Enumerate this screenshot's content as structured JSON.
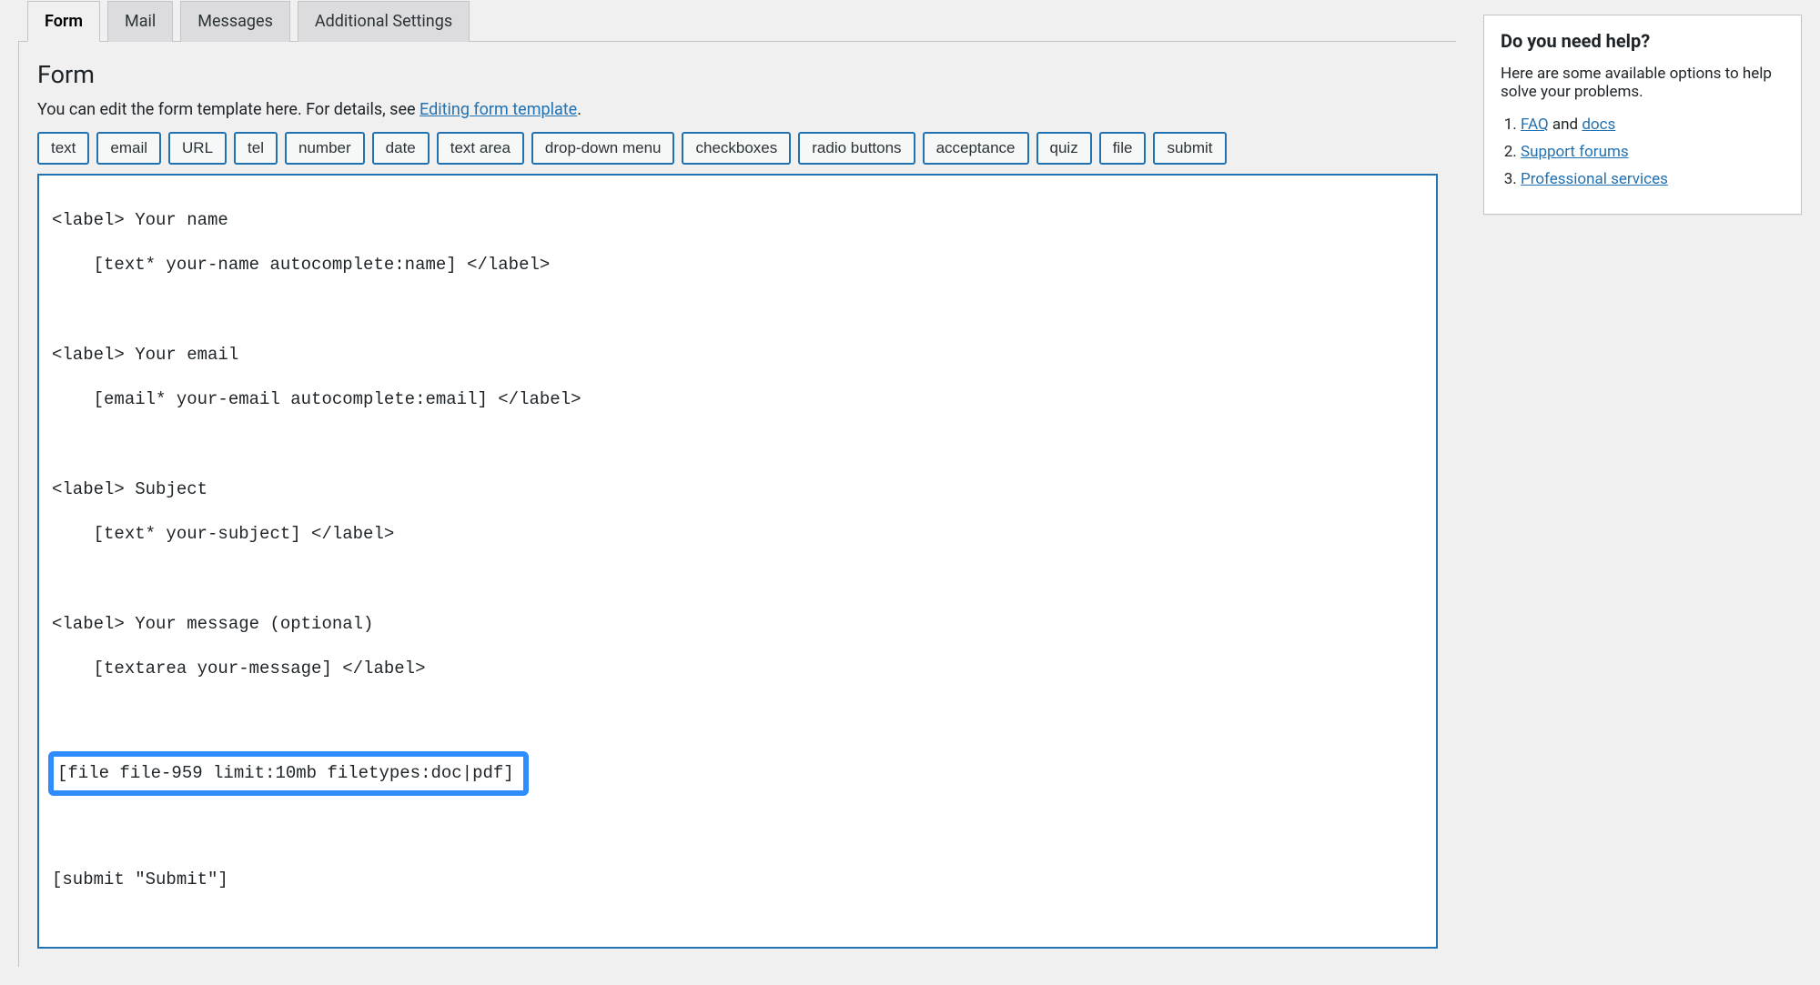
{
  "tabs": [
    {
      "label": "Form",
      "active": true
    },
    {
      "label": "Mail",
      "active": false
    },
    {
      "label": "Messages",
      "active": false
    },
    {
      "label": "Additional Settings",
      "active": false
    }
  ],
  "section_title": "Form",
  "description_prefix": "You can edit the form template here. For details, see ",
  "description_link": "Editing form template",
  "description_suffix": ".",
  "tag_buttons": [
    "text",
    "email",
    "URL",
    "tel",
    "number",
    "date",
    "text area",
    "drop-down menu",
    "checkboxes",
    "radio buttons",
    "acceptance",
    "quiz",
    "file",
    "submit"
  ],
  "code": {
    "l1": "<label> Your name",
    "l2": "    [text* your-name autocomplete:name] </label>",
    "l3": "",
    "l4": "<label> Your email",
    "l5": "    [email* your-email autocomplete:email] </label>",
    "l6": "",
    "l7": "<label> Subject",
    "l8": "    [text* your-subject] </label>",
    "l9": "",
    "l10": "<label> Your message (optional)",
    "l11": "    [textarea your-message] </label>",
    "l12": "",
    "highlighted": "[file file-959 limit:10mb filetypes:doc|pdf]",
    "l14": "",
    "l15": "[submit \"Submit\"]"
  },
  "help": {
    "title": "Do you need help?",
    "intro": "Here are some available options to help solve your problems.",
    "items": [
      {
        "link": "FAQ",
        "suffix": " and ",
        "link2": "docs"
      },
      {
        "link": "Support forums"
      },
      {
        "link": "Professional services"
      }
    ]
  }
}
